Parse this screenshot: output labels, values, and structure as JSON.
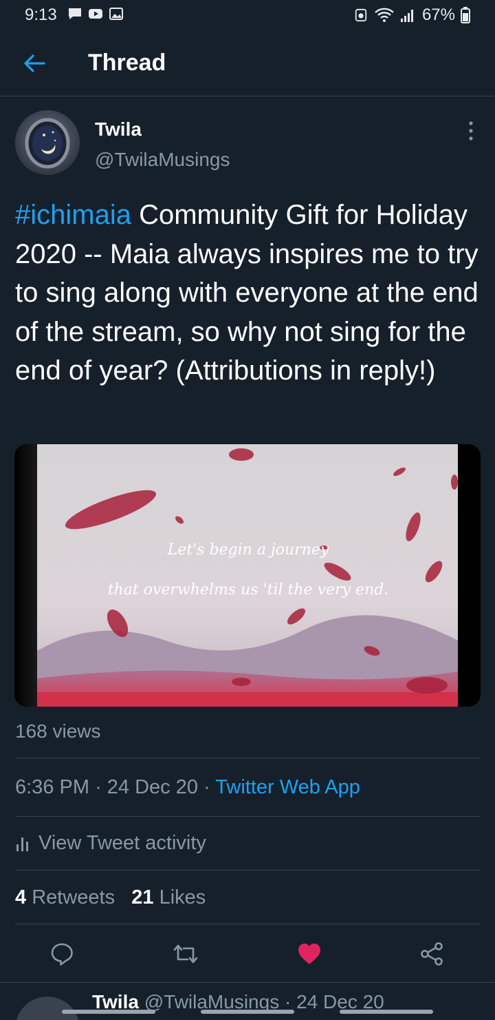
{
  "status_bar": {
    "time": "9:13",
    "battery": "67%"
  },
  "header": {
    "title": "Thread"
  },
  "tweet": {
    "author_name": "Twila",
    "author_handle": "@TwilaMusings",
    "hashtag": "#ichimaia",
    "text": " Community Gift for Holiday 2020 -- Maia always inspires me to try to sing along with everyone at the end of the stream, so why not sing for the end of year? (Attributions in reply!)",
    "media": {
      "caption_line1": "Let's begin a journey",
      "caption_line2": "that overwhelms us 'til the very end."
    },
    "views": "168 views",
    "time": "6:36 PM",
    "date": "24 Dec 20",
    "separator": "·",
    "source": "Twitter Web App",
    "activity_label": "View Tweet activity",
    "retweets_count": "4",
    "retweets_label": "Retweets",
    "likes_count": "21",
    "likes_label": "Likes"
  },
  "actions": [
    "reply-icon",
    "retweet-icon",
    "like-icon",
    "share-icon"
  ],
  "colors": {
    "background": "#15202b",
    "accent": "#1da1f2",
    "like": "#e0245e",
    "muted": "#8899a6",
    "divider": "#38444d"
  },
  "next_reply_peek": {
    "name": "Twila",
    "handle_date": "@TwilaMusings · 24 Dec 20"
  }
}
